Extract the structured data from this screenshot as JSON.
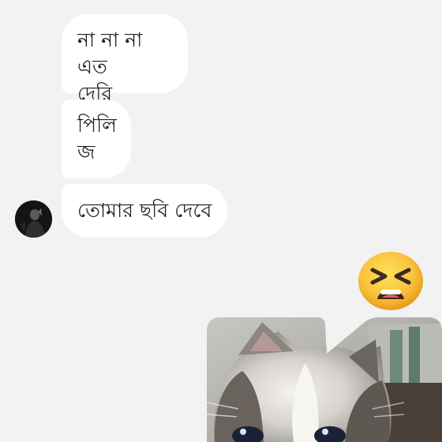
{
  "messages": [
    {
      "text": "না না না এত\nদেরি"
    },
    {
      "text": "পিলি\nজ"
    },
    {
      "text": "তোমার ছবি দেবে"
    }
  ],
  "sender": {
    "avatar": "avatar"
  },
  "reaction": {
    "emoji": "tired-face-emoji"
  },
  "attachment": {
    "type": "image",
    "subject": "kitten"
  },
  "colors": {
    "background": "#f2f2f2",
    "bubble": "#ffffff",
    "text": "#1f1f1f",
    "emoji_yellow": "#f7b830"
  }
}
